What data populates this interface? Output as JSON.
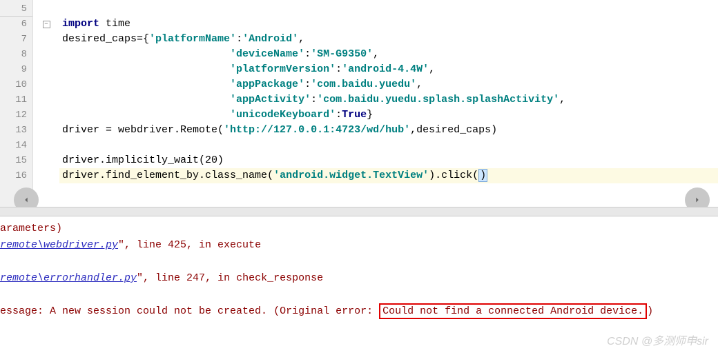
{
  "lines": [
    {
      "n": "5",
      "break": true
    },
    {
      "n": "6"
    },
    {
      "n": "7"
    },
    {
      "n": "8"
    },
    {
      "n": "9"
    },
    {
      "n": "10"
    },
    {
      "n": "11"
    },
    {
      "n": "12"
    },
    {
      "n": "13"
    },
    {
      "n": "14"
    },
    {
      "n": "15"
    },
    {
      "n": "16"
    }
  ],
  "code": {
    "l6": {
      "kw": "import",
      "rest": " time"
    },
    "l7": {
      "pre": "desired_caps={",
      "k": "'platformName'",
      "c": ":",
      "v": "'Android'",
      "post": ","
    },
    "l8": {
      "ind": "                           ",
      "k": "'deviceName'",
      "c": ":",
      "v": "'SM-G9350'",
      "post": ","
    },
    "l9": {
      "ind": "                           ",
      "k": "'platformVersion'",
      "c": ":",
      "v": "'android-4.4W'",
      "post": ","
    },
    "l10": {
      "ind": "                           ",
      "k": "'appPackage'",
      "c": ":",
      "v": "'com.baidu.yuedu'",
      "post": ","
    },
    "l11": {
      "ind": "                           ",
      "k": "'appActivity'",
      "c": ":",
      "v": "'com.baidu.yuedu.splash.splashActivity'",
      "post": ","
    },
    "l12": {
      "ind": "                           ",
      "k": "'unicodeKeyboard'",
      "c": ":",
      "v": "True",
      "post": "}"
    },
    "l13": {
      "pre": "driver = webdriver.Remote(",
      "v": "'http://127.0.0.1:4723/wd/hub'",
      "post": ",desired_caps)"
    },
    "l15": "driver.implicitly_wait(20)",
    "l16": {
      "pre": "driver.find_element_by.class_name(",
      "v": "'android.widget.TextView'",
      "post1": ").click(",
      "cur": ")"
    }
  },
  "console": {
    "l1": "arameters)",
    "l2a": "remote\\webdriver.py",
    "l2b": "\", line 425, in execute",
    "l3a": "remote\\errorhandler.py",
    "l3b": "\", line 247, in check_response",
    "l4a": "essage: A new session could not be created. (Original error: ",
    "l4b": "Could not find a connected Android device.",
    "l4c": ")"
  },
  "watermark": "CSDN @多测师申sir"
}
